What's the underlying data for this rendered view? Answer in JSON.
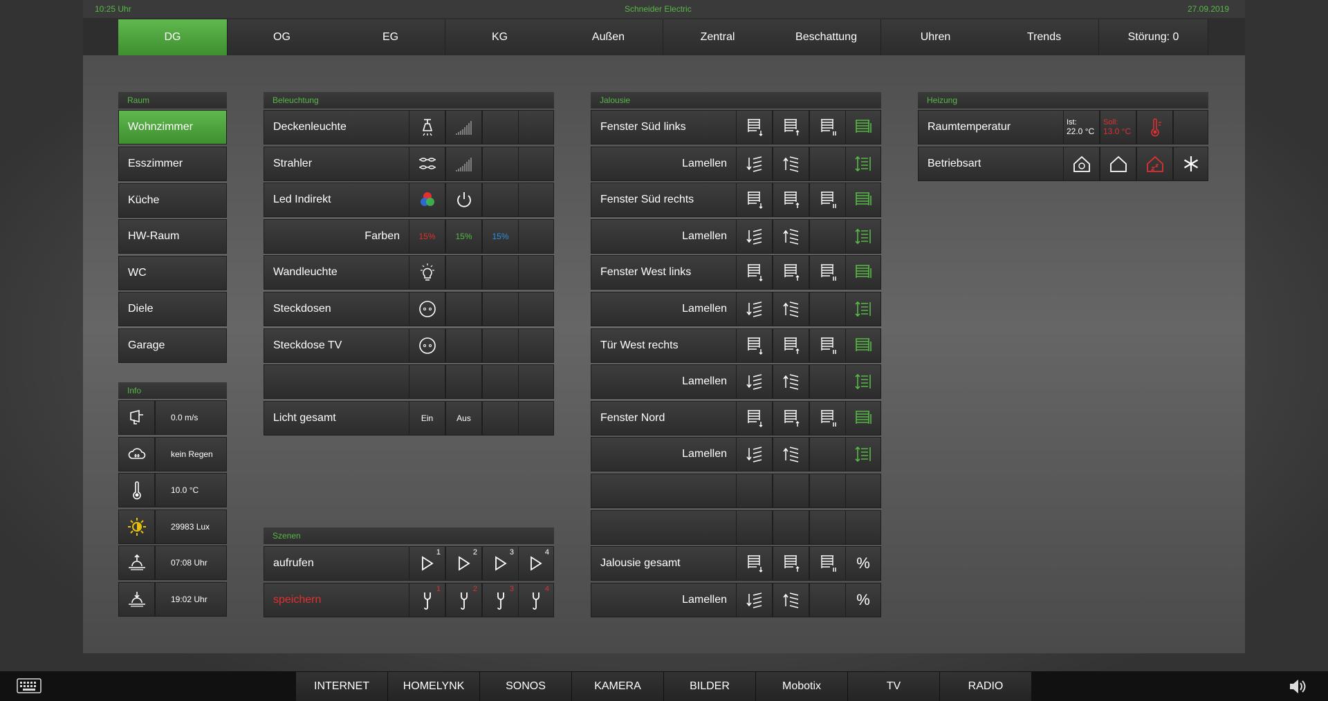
{
  "topbar": {
    "time": "10:25 Uhr",
    "brand": "Schneider Electric",
    "date": "27.09.2019"
  },
  "nav": {
    "tabs": [
      "DG",
      "OG",
      "EG",
      "KG",
      "Außen",
      "Zentral",
      "Beschattung",
      "Uhren",
      "Trends",
      "Störung:  0"
    ],
    "active": "DG"
  },
  "raum": {
    "title": "Raum",
    "items": [
      "Wohnzimmer",
      "Esszimmer",
      "Küche",
      "HW-Raum",
      "WC",
      "Diele",
      "Garage"
    ],
    "active": "Wohnzimmer"
  },
  "info": {
    "title": "Info",
    "rows": [
      {
        "icon": "wind-icon",
        "value": "0.0 m/s"
      },
      {
        "icon": "rain-cloud-icon",
        "value": "kein Regen"
      },
      {
        "icon": "thermometer-icon",
        "value": "10.0 °C"
      },
      {
        "icon": "sun-brightness-icon",
        "value": "29983 Lux"
      },
      {
        "icon": "sunrise-icon",
        "value": "07:08 Uhr"
      },
      {
        "icon": "sunset-icon",
        "value": "19:02 Uhr"
      }
    ]
  },
  "beleuchtung": {
    "title": "Beleuchtung",
    "rows": [
      {
        "label": "Deckenleuchte"
      },
      {
        "label": "Strahler"
      },
      {
        "label": "Led Indirekt"
      },
      {
        "label": "Farben",
        "r": "15%",
        "g": "15%",
        "b": "15%"
      },
      {
        "label": "Wandleuchte"
      },
      {
        "label": "Steckdosen"
      },
      {
        "label": "Steckdose TV"
      },
      {
        "label": ""
      },
      {
        "label": "Licht gesamt",
        "on": "Ein",
        "off": "Aus"
      }
    ]
  },
  "szenen": {
    "title": "Szenen",
    "call_label": "aufrufen",
    "save_label": "speichern",
    "numbers": [
      "1",
      "2",
      "3",
      "4"
    ]
  },
  "jalousie": {
    "title": "Jalousie",
    "rows": [
      "Fenster Süd links",
      "Lamellen",
      "Fenster Süd rechts",
      "Lamellen",
      "Fenster West links",
      "Lamellen",
      "Tür West rechts",
      "Lamellen",
      "Fenster Nord",
      "Lamellen",
      "",
      "",
      "Jalousie gesamt",
      "Lamellen"
    ],
    "percent": "%"
  },
  "heizung": {
    "title": "Heizung",
    "raumtemp_label": "Raumtemperatur",
    "ist_label": "Ist:",
    "ist_value": "22.0 °C",
    "soll_label": "Soll:",
    "soll_value": "13.0 °C",
    "betriebsart_label": "Betriebsart"
  },
  "bottom": {
    "items": [
      "INTERNET",
      "HOMELYNK",
      "SONOS",
      "KAMERA",
      "BILDER",
      "Mobotix",
      "TV",
      "RADIO"
    ]
  },
  "colors": {
    "accent": "#57b947",
    "alert": "#e03030",
    "blue": "#2d8fe0"
  }
}
